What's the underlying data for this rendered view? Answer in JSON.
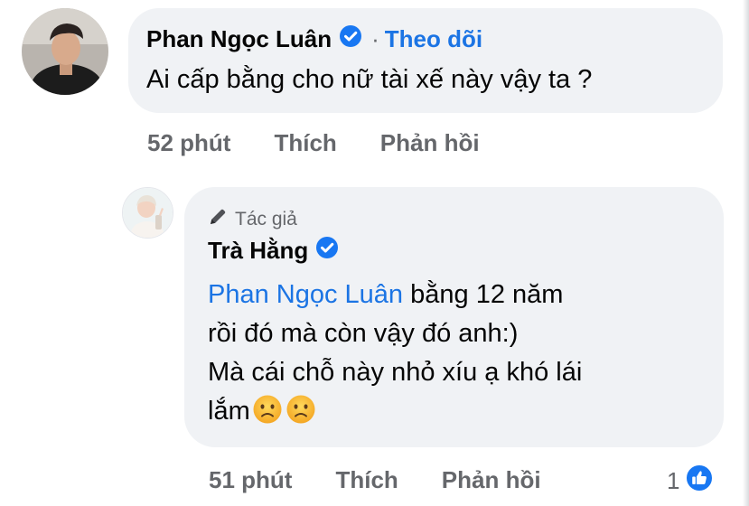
{
  "comment1": {
    "author": "Phan Ngọc Luân",
    "dot": "·",
    "follow_label": "Theo dõi",
    "text": "Ai cấp bằng cho nữ tài xế này vậy ta ?",
    "time": "52 phút",
    "like_label": "Thích",
    "reply_label": "Phản hồi"
  },
  "reply1": {
    "author_badge": "Tác giả",
    "author": "Trà Hằng",
    "mention": "Phan Ngọc Luân",
    "line1_rest": " bằng 12 năm",
    "line2": "rồi đó mà còn vậy đó anh:)",
    "line3": "Mà cái chỗ này nhỏ xíu ạ khó lái",
    "line4": "lắm",
    "emoji": [
      "frowning-face-emoji",
      "frowning-face-emoji"
    ],
    "time": "51 phút",
    "like_label": "Thích",
    "reply_label": "Phản hồi",
    "reaction_count": "1",
    "reaction_icon": "like-icon"
  },
  "colors": {
    "bubble": "#f0f2f5",
    "link": "#1b74e4",
    "secondary_text": "#65676b",
    "verified": "#1877f2"
  }
}
